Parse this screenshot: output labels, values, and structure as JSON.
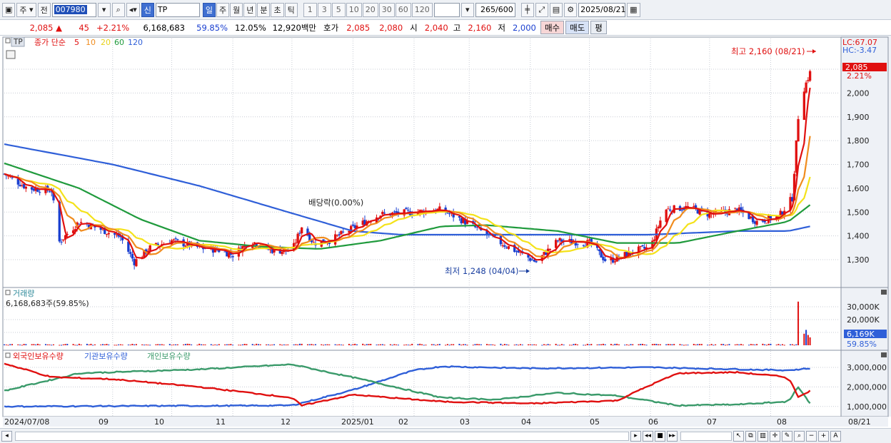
{
  "toolbar": {
    "market": "주",
    "prev_label": "전",
    "code": "007980",
    "new_badge": "신",
    "name": "TP",
    "periods": [
      "일",
      "주",
      "월",
      "년",
      "분",
      "초",
      "틱"
    ],
    "active_period": "일",
    "intervals": [
      "1",
      "3",
      "5",
      "10",
      "20",
      "30",
      "60",
      "120"
    ],
    "count": "265",
    "count_total": "/600",
    "date": "2025/08/21"
  },
  "quote": {
    "price": "2,085 ▲",
    "change": "45",
    "change_pct": "+2.21%",
    "volume": "6,168,683",
    "volume_ratio": "59.85%",
    "turnover": "12.05%",
    "amount": "12,920백만",
    "ask_label": "호가",
    "ask": "2,085",
    "bid": "2,080",
    "open_label": "시",
    "open": "2,040",
    "high_label": "고",
    "high": "2,160",
    "low_label": "저",
    "low": "2,000",
    "buy_label": "매수",
    "sell_label": "매도",
    "eval_label": "평"
  },
  "price_panel": {
    "ticker_tag": "TP",
    "legend_prefix": "종가 단순",
    "ma_labels": [
      "5",
      "10",
      "20",
      "60",
      "120"
    ],
    "ma_colors": [
      "#e01010",
      "#f08c1e",
      "#f4e21a",
      "#1f9a3c",
      "#2f5fd8"
    ],
    "lc_label": "LC:67.07",
    "hc_label": "HC:-3.47",
    "current_price_label": "2,085",
    "current_pct_label": "2.21%",
    "max_annotation": "최고 2,160 (08/21)",
    "min_annotation": "최저 1,248 (04/04)",
    "dividend_annotation": "배당락(0.00%)",
    "y_ticks": [
      "2,100",
      "2,000",
      "1,900",
      "1,800",
      "1,700",
      "1,600",
      "1,500",
      "1,400",
      "1,300"
    ]
  },
  "volume_panel": {
    "title": "거래량",
    "current_label": "6,168,683주(59.85%)",
    "y_ticks": [
      "30,000K",
      "20,000K",
      "10,000K"
    ],
    "current_value_label": "6,169K",
    "current_pct_label": "59.85%"
  },
  "holdings_panel": {
    "series_labels": [
      "외국인보유수량",
      "기관보유수량",
      "개인보유수량"
    ],
    "series_colors": [
      "#e01010",
      "#2f5fd8",
      "#3a9a6a"
    ],
    "y_ticks": [
      "3,000,000",
      "2,000,000",
      "1,000,000"
    ]
  },
  "x_axis": {
    "labels": [
      "2024/07/08",
      "09",
      "10",
      "11",
      "12",
      "2025/01",
      "02",
      "03",
      "04",
      "05",
      "06",
      "07",
      "08",
      "08/21"
    ]
  },
  "chart_data": {
    "type": "line",
    "dates_start": "2024/07/08",
    "dates_end": "2025/08/21",
    "price_ylim": [
      1200,
      2160
    ],
    "close_keypoints": [
      [
        "2024-07-08",
        1660
      ],
      [
        "2024-07-20",
        1600
      ],
      [
        "2024-08-01",
        1590
      ],
      [
        "2024-08-05",
        1375
      ],
      [
        "2024-08-15",
        1460
      ],
      [
        "2024-08-25",
        1430
      ],
      [
        "2024-09-05",
        1395
      ],
      [
        "2024-09-12",
        1290
      ],
      [
        "2024-09-20",
        1350
      ],
      [
        "2024-10-01",
        1380
      ],
      [
        "2024-10-15",
        1350
      ],
      [
        "2024-10-25",
        1340
      ],
      [
        "2024-11-01",
        1320
      ],
      [
        "2024-11-10",
        1380
      ],
      [
        "2024-11-20",
        1340
      ],
      [
        "2024-12-01",
        1335
      ],
      [
        "2024-12-06",
        1440
      ],
      [
        "2024-12-12",
        1370
      ],
      [
        "2024-12-20",
        1380
      ],
      [
        "2025-01-05",
        1450
      ],
      [
        "2025-01-15",
        1490
      ],
      [
        "2025-02-01",
        1500
      ],
      [
        "2025-02-15",
        1510
      ],
      [
        "2025-03-01",
        1450
      ],
      [
        "2025-03-15",
        1380
      ],
      [
        "2025-04-04",
        1290
      ],
      [
        "2025-04-15",
        1380
      ],
      [
        "2025-05-01",
        1370
      ],
      [
        "2025-05-10",
        1290
      ],
      [
        "2025-05-25",
        1340
      ],
      [
        "2025-06-01",
        1350
      ],
      [
        "2025-06-08",
        1510
      ],
      [
        "2025-06-20",
        1520
      ],
      [
        "2025-07-01",
        1490
      ],
      [
        "2025-07-15",
        1510
      ],
      [
        "2025-07-25",
        1460
      ],
      [
        "2025-08-05",
        1480
      ],
      [
        "2025-08-12",
        1560
      ],
      [
        "2025-08-15",
        1900
      ],
      [
        "2025-08-18",
        2020
      ],
      [
        "2025-08-21",
        2085
      ]
    ],
    "ma60_keypoints": [
      [
        "2024-07-08",
        1705
      ],
      [
        "2024-08-15",
        1600
      ],
      [
        "2024-09-15",
        1470
      ],
      [
        "2024-10-15",
        1380
      ],
      [
        "2024-11-15",
        1355
      ],
      [
        "2024-12-15",
        1345
      ],
      [
        "2025-01-15",
        1380
      ],
      [
        "2025-02-15",
        1440
      ],
      [
        "2025-03-10",
        1445
      ],
      [
        "2025-04-15",
        1420
      ],
      [
        "2025-05-15",
        1370
      ],
      [
        "2025-06-15",
        1370
      ],
      [
        "2025-07-15",
        1420
      ],
      [
        "2025-08-10",
        1460
      ],
      [
        "2025-08-21",
        1530
      ]
    ],
    "ma120_keypoints": [
      [
        "2024-07-08",
        1785
      ],
      [
        "2024-09-01",
        1700
      ],
      [
        "2024-10-15",
        1610
      ],
      [
        "2024-12-01",
        1495
      ],
      [
        "2025-01-01",
        1420
      ],
      [
        "2025-01-25",
        1405
      ],
      [
        "2025-06-01",
        1405
      ],
      [
        "2025-06-15",
        1410
      ],
      [
        "2025-07-15",
        1420
      ],
      [
        "2025-08-10",
        1420
      ],
      [
        "2025-08-21",
        1440
      ]
    ],
    "volume_k_spikes": [
      [
        "2025-08-15",
        34000
      ],
      [
        "2025-08-18",
        9000
      ],
      [
        "2025-08-19",
        12000
      ],
      [
        "2025-08-20",
        8000
      ],
      [
        "2025-08-21",
        6169
      ]
    ],
    "holdings": {
      "foreign": [
        [
          "2024-07-08",
          3200000
        ],
        [
          "2024-08-01",
          2500000
        ],
        [
          "2024-09-01",
          2400000
        ],
        [
          "2024-10-15",
          2000000
        ],
        [
          "2024-12-01",
          1450000
        ],
        [
          "2024-12-06",
          1050000
        ],
        [
          "2025-01-01",
          1600000
        ],
        [
          "2025-02-15",
          1250000
        ],
        [
          "2025-04-01",
          1150000
        ],
        [
          "2025-05-15",
          1300000
        ],
        [
          "2025-06-01",
          2100000
        ],
        [
          "2025-06-15",
          2700000
        ],
        [
          "2025-07-15",
          2750000
        ],
        [
          "2025-08-10",
          2500000
        ],
        [
          "2025-08-15",
          1500000
        ],
        [
          "2025-08-21",
          1800000
        ]
      ],
      "institution": [
        [
          "2024-07-08",
          1000000
        ],
        [
          "2024-12-01",
          1050000
        ],
        [
          "2025-01-01",
          1850000
        ],
        [
          "2025-02-01",
          2850000
        ],
        [
          "2025-02-15",
          3050000
        ],
        [
          "2025-04-01",
          2950000
        ],
        [
          "2025-06-01",
          3000000
        ],
        [
          "2025-08-10",
          2850000
        ],
        [
          "2025-08-21",
          2950000
        ]
      ],
      "individual": [
        [
          "2024-07-08",
          1800000
        ],
        [
          "2024-08-15",
          2700000
        ],
        [
          "2024-10-15",
          2900000
        ],
        [
          "2024-12-01",
          3150000
        ],
        [
          "2025-01-05",
          2400000
        ],
        [
          "2025-02-15",
          1450000
        ],
        [
          "2025-03-15",
          1350000
        ],
        [
          "2025-04-15",
          1700000
        ],
        [
          "2025-05-15",
          1550000
        ],
        [
          "2025-06-15",
          1050000
        ],
        [
          "2025-07-15",
          1100000
        ],
        [
          "2025-08-10",
          1250000
        ],
        [
          "2025-08-15",
          2000000
        ],
        [
          "2025-08-21",
          1150000
        ]
      ]
    }
  }
}
